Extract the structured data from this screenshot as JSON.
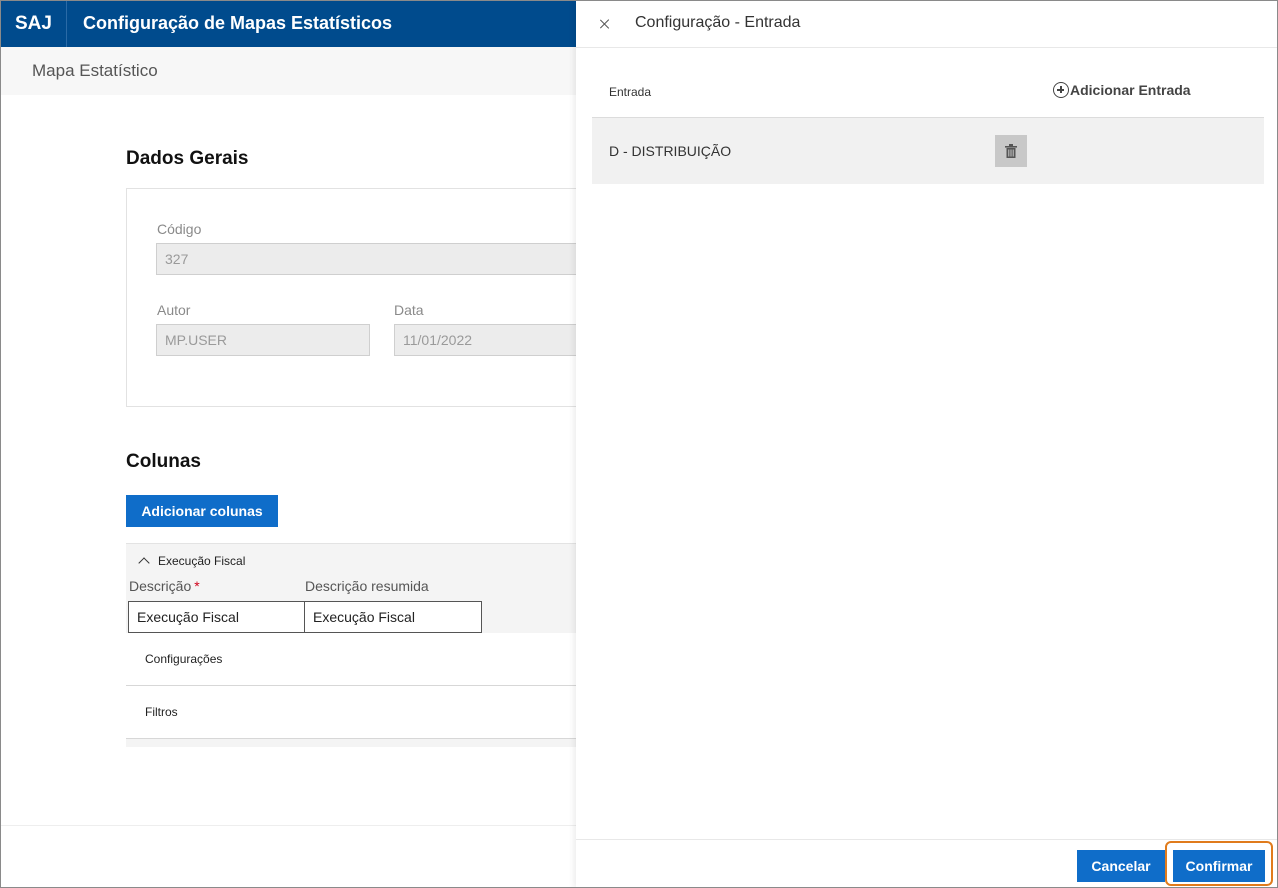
{
  "appbar": {
    "brand": "SAJ",
    "title": "Configuração de Mapas Estatísticos"
  },
  "breadcrumb": {
    "label": "Mapa Estatístico"
  },
  "general": {
    "title": "Dados Gerais",
    "code_label": "Código",
    "code_value": "327",
    "author_label": "Autor",
    "author_value": "MP.USER",
    "date_label": "Data",
    "date_value": "11/01/2022"
  },
  "columns": {
    "title": "Colunas",
    "add_button": "Adicionar colunas",
    "group": {
      "title": "Execução Fiscal",
      "desc_label": "Descrição",
      "desc_required": "*",
      "desc_value": "Execução Fiscal",
      "short_desc_label": "Descrição resumida",
      "short_desc_value": "Execução Fiscal",
      "rows": [
        "Configurações",
        "Filtros"
      ]
    }
  },
  "panel": {
    "title": "Configuração - Entrada",
    "column_header": "Entrada",
    "add_entry": "Adicionar Entrada",
    "entries": [
      "D - DISTRIBUIÇÃO"
    ],
    "cancel": "Cancelar",
    "confirm": "Confirmar"
  },
  "colors": {
    "appbar": "#004b8d",
    "primary": "#0f6dc9",
    "highlight": "#e07b1c"
  }
}
